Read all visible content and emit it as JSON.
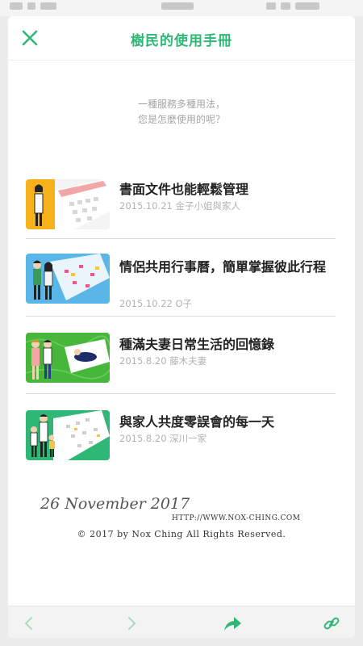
{
  "header": {
    "title": "樹民的使用手冊"
  },
  "intro": {
    "line1": "一種服務多種用法，",
    "line2": "您是怎麼使用的呢？"
  },
  "articles": [
    {
      "title": "書面文件也能輕鬆管理",
      "meta": "2015.10.21 金子小姐與家人"
    },
    {
      "title": "情侶共用行事曆，簡單掌握彼此行程",
      "meta": "2015.10.22 O子"
    },
    {
      "title": "種滿夫妻日常生活的回憶錄",
      "meta": "2015.8.20 藤木夫妻"
    },
    {
      "title": "與家人共度零誤會的每一天",
      "meta": "2015.8.20 深川一家"
    }
  ],
  "watermark": {
    "date": "26 November 2017",
    "url": "HTTP://WWW.NOX-CHING.COM",
    "copyright": "© 2017 by Nox Ching All Rights Reserved."
  },
  "icons": {
    "close": "close-icon",
    "back": "chevron-left-icon",
    "forward": "chevron-right-icon",
    "share": "share-icon",
    "link": "link-icon"
  },
  "colors": {
    "accent": "#2fb776",
    "meta": "#b3b3b3",
    "text": "#222222"
  }
}
